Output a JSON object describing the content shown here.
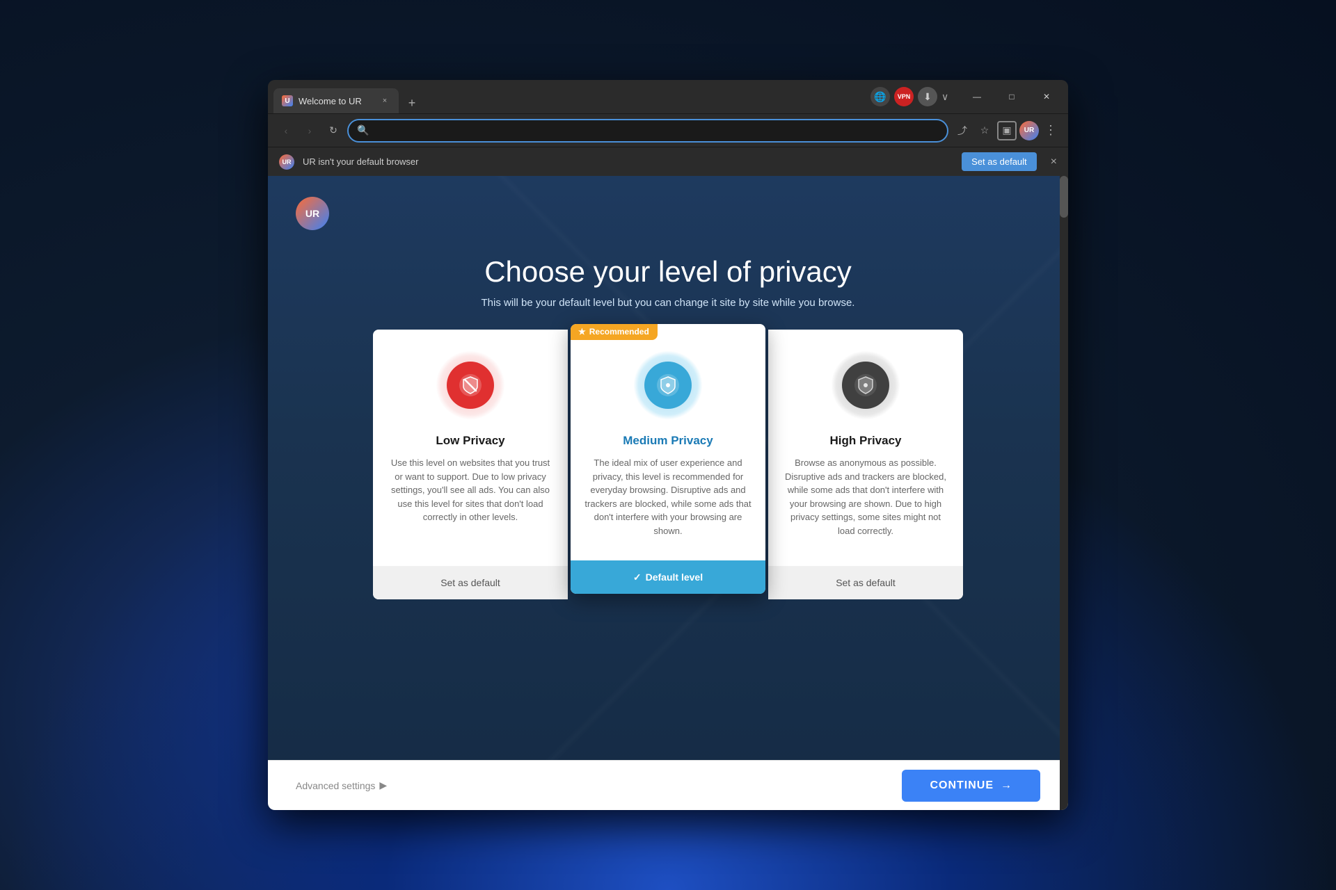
{
  "desktop": {
    "background": "#0d1b2e"
  },
  "browser": {
    "tab": {
      "favicon_label": "U",
      "title": "Welcome to UR",
      "close_label": "×"
    },
    "new_tab_label": "+",
    "toolbar": {
      "vpn_label": "VPN",
      "chevron_label": "∨",
      "minimize_label": "—",
      "maximize_label": "□",
      "close_label": "✕"
    },
    "nav": {
      "back_label": "‹",
      "forward_label": "›",
      "refresh_label": "↻",
      "search_placeholder": "",
      "menu_label": "⋮"
    },
    "banner": {
      "logo_label": "UR",
      "text": "UR isn't your default browser",
      "set_default_label": "Set as default",
      "close_label": "×"
    }
  },
  "page": {
    "logo_label": "UR",
    "title": "Choose your level of privacy",
    "subtitle": "This will be your default level but you can change it site by site while you browse.",
    "cards": [
      {
        "id": "low",
        "name": "Low Privacy",
        "icon_color": "red",
        "badge": null,
        "description": "Use this level on websites that you trust or want to support. Due to low privacy settings, you'll see all ads. You can also use this level for sites that don't load correctly in other levels.",
        "footer_label": "Set as default",
        "is_default": false
      },
      {
        "id": "medium",
        "name": "Medium Privacy",
        "icon_color": "blue",
        "badge": "Recommended",
        "badge_star": "★",
        "description": "The ideal mix of user experience and privacy, this level is recommended for everyday browsing. Disruptive ads and trackers are blocked, while some ads that don't interfere with your browsing are shown.",
        "footer_label": "Default level",
        "is_default": true
      },
      {
        "id": "high",
        "name": "High Privacy",
        "icon_color": "gray",
        "badge": null,
        "description": "Browse as anonymous as possible. Disruptive ads and trackers are blocked, while some ads that don't interfere with your browsing are shown. Due to high privacy settings, some sites might not load correctly.",
        "footer_label": "Set as default",
        "is_default": false
      }
    ],
    "footer": {
      "advanced_settings_label": "Advanced settings",
      "advanced_settings_arrow": "▶",
      "continue_label": "CONTINUE",
      "continue_arrow": "→"
    }
  }
}
